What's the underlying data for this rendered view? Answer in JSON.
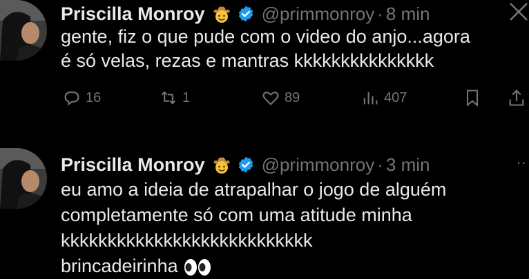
{
  "tweets": [
    {
      "name": "Priscilla Monroy",
      "handle": "@primmonroy",
      "separator": "·",
      "time": "8 min",
      "lines": [
        "gente, fiz o que pude com o video do anjo...agora",
        "é só velas, rezas e mantras kkkkkkkkkkkkkkk"
      ],
      "replies": "16",
      "retweets": "1",
      "likes": "89",
      "views": "407"
    },
    {
      "name": "Priscilla Monroy",
      "handle": "@primmonroy",
      "separator": "·",
      "time": "3 min",
      "more": "··",
      "lines": [
        "eu amo a ideia de atrapalhar o jogo de alguém",
        "completamente só com uma atitude minha",
        "kkkkkkkkkkkkkkkkkkkkkkkkkkk",
        "brincadeirinha"
      ]
    }
  ],
  "icons": {
    "name_emoji": "cowboy-face-emoji",
    "verified": "verified-badge-icon",
    "x_logo": "x-logo-icon",
    "eyes": "eyes-emoji",
    "accent": "#1d9bf0",
    "muted": "#71767b",
    "text": "#e7e9ea"
  }
}
